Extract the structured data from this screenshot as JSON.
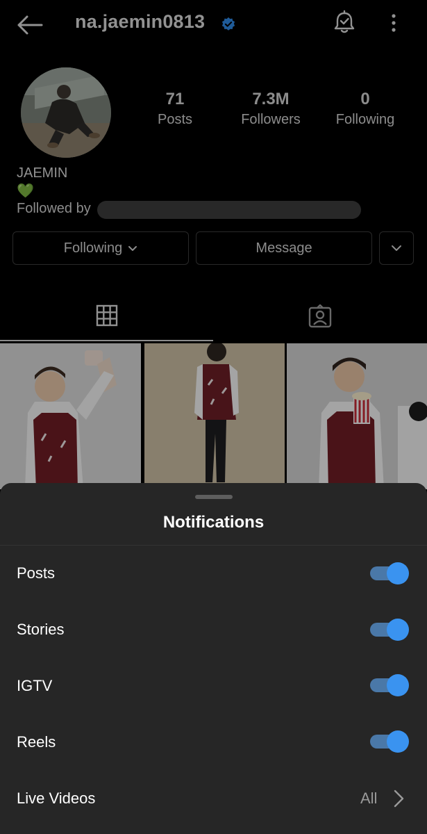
{
  "header": {
    "username": "na.jaemin0813",
    "back_icon": "arrow-left-icon",
    "verified_icon": "verified-badge-icon",
    "verified_color": "#3897f0",
    "bell_icon": "bell-check-icon",
    "menu_icon": "kebab-menu-icon"
  },
  "profile": {
    "stats": [
      {
        "value": "71",
        "label": "Posts"
      },
      {
        "value": "7.3M",
        "label": "Followers"
      },
      {
        "value": "0",
        "label": "Following"
      }
    ],
    "display_name": "JAEMIN",
    "bio_emoji": "💚",
    "followed_by": "Followed by"
  },
  "actions": {
    "following_label": "Following",
    "message_label": "Message",
    "more_icon": "chevron-down-icon"
  },
  "tabs": [
    {
      "icon": "grid-icon",
      "selected": true
    },
    {
      "icon": "tagged-user-icon",
      "selected": false
    }
  ],
  "sheet": {
    "title": "Notifications",
    "rows": [
      {
        "label": "Posts",
        "enabled": true
      },
      {
        "label": "Stories",
        "enabled": true
      },
      {
        "label": "IGTV",
        "enabled": true
      },
      {
        "label": "Reels",
        "enabled": true
      }
    ],
    "live": {
      "label": "Live Videos",
      "value": "All"
    },
    "toggle_color": "#3a93f0"
  }
}
